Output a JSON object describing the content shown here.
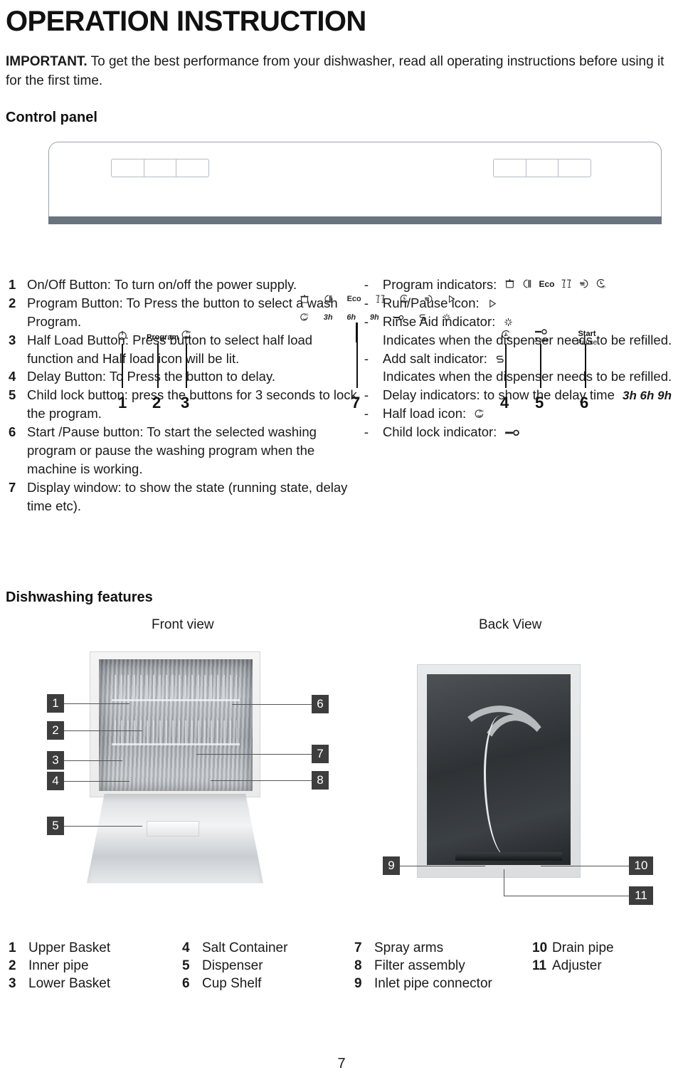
{
  "header": {
    "title": "OPERATION INSTRUCTION",
    "important_bold": "IMPORTANT.",
    "important_text": " To get the best performance from your dishwasher, read all operating instructions before using it for the first time.",
    "control_panel_heading": "Control panel"
  },
  "control_panel": {
    "labels": {
      "power": "⏻",
      "program": "Program",
      "half_load": "½",
      "delay": "delay-clock",
      "child_lock_sec": "3 sec",
      "start": "Start",
      "pause": "Pause"
    },
    "icons_top_row": [
      "pot-icon",
      "half-plate-icon",
      "Eco",
      "glasses-icon",
      "clock-1h-icon",
      "plate-lines-icon",
      "play-icon"
    ],
    "icons_top_row_text": [
      "",
      "",
      "Eco",
      "",
      "",
      "",
      ""
    ],
    "icons_bottom_row": [
      "half-load-icon",
      "3h",
      "6h",
      "9h",
      "key-icon",
      "salt-icon",
      "rinse-aid-icon"
    ],
    "icons_bottom_row_text": [
      "",
      "3h",
      "6h",
      "9h",
      "",
      "",
      ""
    ],
    "callout_numbers": [
      "1",
      "2",
      "3",
      "7",
      "4",
      "5",
      "6"
    ]
  },
  "instructions": [
    {
      "n": "1",
      "text": "On/Off Button: To turn on/off the power supply."
    },
    {
      "n": "2",
      "text": "Program Button: To Press the button to select a wash Program."
    },
    {
      "n": "3",
      "text": "Half Load Button: Press button to select half load function and Half load icon will be lit."
    },
    {
      "n": "4",
      "text": "Delay Button: To Press the button to delay."
    },
    {
      "n": "5",
      "text": "Child lock button: press the buttons for 3 seconds to lock the program."
    },
    {
      "n": "6",
      "text": "Start /Pause button: To start the selected washing program or pause the washing program when the machine is working."
    },
    {
      "n": "7",
      "text": "Display window: to show the state (running state, delay time etc)."
    }
  ],
  "indicators": {
    "program_label": "Program indicators:",
    "run_pause_label": "Run/Pause icon:",
    "rinse_aid_label": "Rinse Aid indicator:",
    "rinse_aid_note": "Indicates when the dispenser needs to be refilled.",
    "add_salt_label": "Add salt indicator:",
    "add_salt_note": "Indicates when the dispenser needs to be refilled.",
    "delay_label": "Delay indicators: to show the delay time",
    "delay_times": "3h  6h  9h",
    "half_load_label": "Half load icon:",
    "child_lock_label": "Child lock indicator:",
    "dash": "-"
  },
  "features": {
    "heading": "Dishwashing features",
    "front_view": "Front  view",
    "back_view": "Back View",
    "front_callouts": [
      "1",
      "2",
      "3",
      "4",
      "5",
      "6",
      "7",
      "8"
    ],
    "back_callouts": [
      "9",
      "10",
      "11"
    ]
  },
  "legend": {
    "col1": [
      {
        "n": "1",
        "label": "Upper Basket"
      },
      {
        "n": "2",
        "label": "Inner pipe"
      },
      {
        "n": "3",
        "label": "Lower Basket"
      }
    ],
    "col2": [
      {
        "n": "4",
        "label": "Salt Container"
      },
      {
        "n": "5",
        "label": "Dispenser"
      },
      {
        "n": "6",
        "label": "Cup Shelf"
      }
    ],
    "col3": [
      {
        "n": "7",
        "label": "Spray arms"
      },
      {
        "n": "8",
        "label": "Filter assembly"
      },
      {
        "n": "9",
        "label": "Inlet pipe connector"
      }
    ],
    "col4": [
      {
        "n": "10",
        "label": "Drain pipe"
      },
      {
        "n": "11",
        "label": "Adjuster"
      }
    ]
  },
  "page_number": "7",
  "colors": {
    "panel_bar": "#69747e",
    "callout_bg": "#3d3d3d",
    "text": "#1a1a1a"
  }
}
